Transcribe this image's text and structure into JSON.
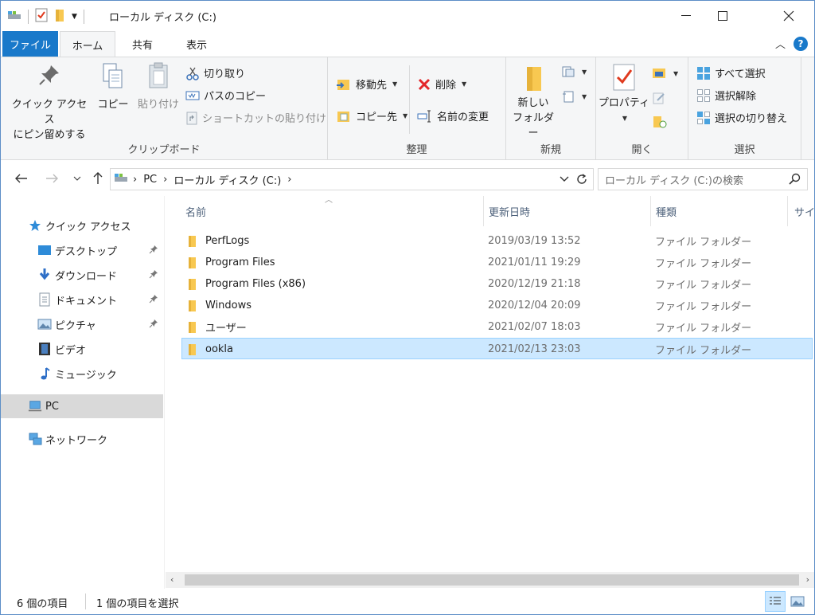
{
  "window": {
    "title": "ローカル ディスク (C:)"
  },
  "tabs": {
    "file": "ファイル",
    "home": "ホーム",
    "share": "共有",
    "view": "表示",
    "help": "?"
  },
  "ribbon": {
    "clipboard": {
      "label": "クリップボード",
      "pin_line1": "クイック アクセス",
      "pin_line2": "にピン留めする",
      "copy": "コピー",
      "paste": "貼り付け",
      "cut": "切り取り",
      "copy_path": "パスのコピー",
      "paste_shortcut": "ショートカットの貼り付け"
    },
    "organize": {
      "label": "整理",
      "move_to": "移動先",
      "copy_to": "コピー先",
      "delete": "削除",
      "rename": "名前の変更"
    },
    "new": {
      "label": "新規",
      "new_folder_line1": "新しい",
      "new_folder_line2": "フォルダー"
    },
    "open": {
      "label": "開く",
      "properties": "プロパティ"
    },
    "select": {
      "label": "選択",
      "select_all": "すべて選択",
      "select_none": "選択解除",
      "invert": "選択の切り替え"
    }
  },
  "address": {
    "crumbs": [
      "PC",
      "ローカル ディスク (C:)"
    ],
    "search_placeholder": "ローカル ディスク (C:)の検索"
  },
  "nav": {
    "quick_access": "クイック アクセス",
    "desktop": "デスクトップ",
    "downloads": "ダウンロード",
    "documents": "ドキュメント",
    "pictures": "ピクチャ",
    "videos": "ビデオ",
    "music": "ミュージック",
    "pc": "PC",
    "network": "ネットワーク"
  },
  "columns": {
    "name": "名前",
    "date": "更新日時",
    "type": "種類",
    "size": "サイ"
  },
  "files": [
    {
      "name": "PerfLogs",
      "date": "2019/03/19 13:52",
      "type": "ファイル フォルダー"
    },
    {
      "name": "Program Files",
      "date": "2021/01/11 19:29",
      "type": "ファイル フォルダー"
    },
    {
      "name": "Program Files (x86)",
      "date": "2020/12/19 21:18",
      "type": "ファイル フォルダー"
    },
    {
      "name": "Windows",
      "date": "2020/12/04 20:09",
      "type": "ファイル フォルダー"
    },
    {
      "name": "ユーザー",
      "date": "2021/02/07 18:03",
      "type": "ファイル フォルダー"
    },
    {
      "name": "ookla",
      "date": "2021/02/13 23:03",
      "type": "ファイル フォルダー"
    }
  ],
  "status": {
    "count": "6 個の項目",
    "selected": "1 個の項目を選択"
  },
  "colors": {
    "accent": "#1979ca",
    "selection": "#cce8ff",
    "folder": "#f8c851"
  }
}
